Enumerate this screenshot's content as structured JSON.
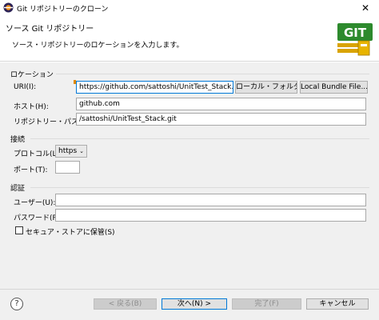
{
  "window": {
    "title": "Git リポジトリーのクローン",
    "close": "✕"
  },
  "header": {
    "title": "ソース Git リポジトリー",
    "description": "ソース・リポジトリーのロケーションを入力します。",
    "logo_text": "GIT"
  },
  "location": {
    "group_label": "ロケーション",
    "uri_label": "URI(I):",
    "uri_value": "https://github.com/sattoshi/UnitTest_Stack.git",
    "local_folder_button": "ローカル・フォルダー...",
    "local_bundle_button": "Local Bundle File...",
    "host_label": "ホスト(H):",
    "host_value": "github.com",
    "repo_path_label": "リポジトリー・パス(R):",
    "repo_path_value": "/sattoshi/UnitTest_Stack.git"
  },
  "connection": {
    "group_label": "接続",
    "protocol_label": "プロトコル(L):",
    "protocol_value": "https",
    "port_label": "ポート(T):",
    "port_value": ""
  },
  "auth": {
    "group_label": "認証",
    "user_label": "ユーザー(U):",
    "user_value": "",
    "password_label": "パスワード(P):",
    "password_value": "",
    "secure_store_label": "セキュア・ストアに保管(S)",
    "secure_store_checked": false
  },
  "footer": {
    "help": "?",
    "back_button": "< 戻る(B)",
    "next_button": "次へ(N) >",
    "finish_button": "完了(F)",
    "cancel_button": "キャンセル"
  },
  "colors": {
    "accent": "#0078d7",
    "background": "#f0f0f0",
    "logo_bg": "#2d8a2d"
  }
}
